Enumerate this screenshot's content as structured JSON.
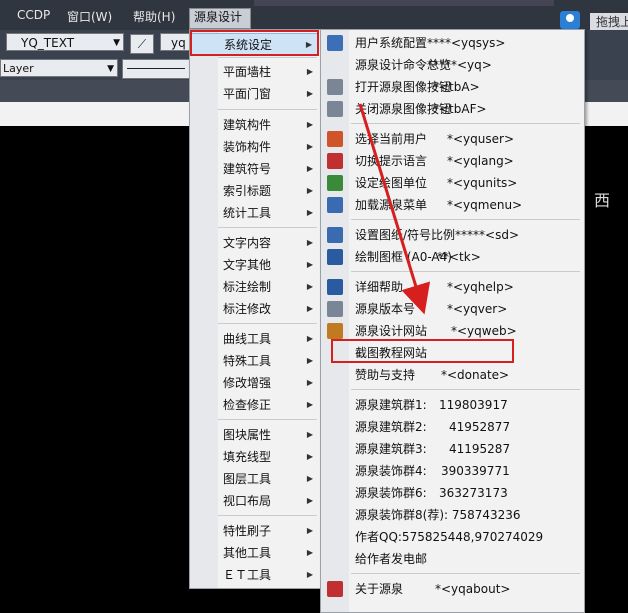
{
  "menubar": {
    "items": [
      "CCDP",
      "窗口(W)",
      "帮助(H)",
      "源泉设计"
    ],
    "drag_label": "拖拽上"
  },
  "toolbar": {
    "text_style": "YQ_TEXT",
    "style2": "yq",
    "layer": "Layer"
  },
  "viewcube_label": "西",
  "menu1": {
    "items": [
      {
        "label": "系统设定",
        "submenu": true
      },
      {
        "label": "平面墙柱",
        "submenu": true
      },
      {
        "label": "平面门窗",
        "submenu": true
      },
      {
        "label": "建筑构件",
        "submenu": true
      },
      {
        "label": "装饰构件",
        "submenu": true
      },
      {
        "label": "建筑符号",
        "submenu": true
      },
      {
        "label": "索引标题",
        "submenu": true
      },
      {
        "label": "统计工具",
        "submenu": true
      },
      {
        "label": "文字内容",
        "submenu": true
      },
      {
        "label": "文字其他",
        "submenu": true
      },
      {
        "label": "标注绘制",
        "submenu": true
      },
      {
        "label": "标注修改",
        "submenu": true
      },
      {
        "label": "曲线工具",
        "submenu": true
      },
      {
        "label": "特殊工具",
        "submenu": true
      },
      {
        "label": "修改增强",
        "submenu": true
      },
      {
        "label": "检查修正",
        "submenu": true
      },
      {
        "label": "图块属性",
        "submenu": true
      },
      {
        "label": "填充线型",
        "submenu": true
      },
      {
        "label": "图层工具",
        "submenu": true
      },
      {
        "label": "视口布局",
        "submenu": true
      },
      {
        "label": "特性刷子",
        "submenu": true
      },
      {
        "label": "其他工具",
        "submenu": true
      },
      {
        "label": "ＥＴ工具",
        "submenu": true
      }
    ]
  },
  "menu2": {
    "items": [
      {
        "label": "用户系统配置",
        "cmd": "****<yqsys>",
        "icon": "settings-icon",
        "color": "#3b6fb6"
      },
      {
        "label": "源泉设计命令总览",
        "cmd": "*****<yq>",
        "icon": "",
        "color": ""
      },
      {
        "label": "打开源泉图像按钮",
        "cmd": "*<tbA>",
        "icon": "toolbar-icon",
        "color": "#7a8696"
      },
      {
        "label": "关闭源泉图像按钮",
        "cmd": "*<tbAF>",
        "icon": "toolbar-off-icon",
        "color": "#7a8696"
      },
      {
        "label": "选择当前用户",
        "cmd": "*<yquser>",
        "icon": "user-icon",
        "color": "#d0542a"
      },
      {
        "label": "切换提示语言",
        "cmd": "*<yqlang>",
        "icon": "language-icon",
        "color": "#c03030"
      },
      {
        "label": "设定绘图单位",
        "cmd": "*<yqunits>",
        "icon": "units-icon",
        "color": "#3a8a3a"
      },
      {
        "label": "加载源泉菜单",
        "cmd": "*<yqmenu>",
        "icon": "menu-icon",
        "color": "#3a6ab0"
      },
      {
        "label": "设置图纸/符号比例*****<sd>",
        "cmd": "",
        "icon": "scale-icon",
        "color": "#3a6ab0"
      },
      {
        "label": "绘制图框 (A0-A4)",
        "cmd": "**<tk>",
        "icon": "frame-icon",
        "color": "#2a5aa0"
      },
      {
        "label": "详细帮助",
        "cmd": "*<yqhelp>",
        "icon": "help-icon",
        "color": "#2a5aa0"
      },
      {
        "label": "源泉版本号",
        "cmd": "*<yqver>",
        "icon": "version-icon",
        "color": "#7a8696"
      },
      {
        "label": "源泉设计网站",
        "cmd": "*<yqweb>",
        "icon": "home-icon",
        "color": "#c07a20"
      },
      {
        "label": "截图教程网站",
        "cmd": "",
        "icon": "",
        "color": ""
      },
      {
        "label": "赞助与支持",
        "cmd": "*<donate>",
        "icon": "",
        "color": ""
      },
      {
        "label": "源泉建筑群1:",
        "cmd": "119803917",
        "icon": "",
        "color": ""
      },
      {
        "label": "源泉建筑群2:",
        "cmd": "41952877",
        "icon": "",
        "color": ""
      },
      {
        "label": "源泉建筑群3:",
        "cmd": "41195287",
        "icon": "",
        "color": ""
      },
      {
        "label": "源泉装饰群4:",
        "cmd": "390339771",
        "icon": "",
        "color": ""
      },
      {
        "label": "源泉装饰群6:",
        "cmd": "363273173",
        "icon": "",
        "color": ""
      },
      {
        "label": "源泉装饰群8(荐): 758743236",
        "cmd": "",
        "icon": "",
        "color": ""
      },
      {
        "label": "作者QQ:575825448,970274029",
        "cmd": "",
        "icon": "",
        "color": ""
      },
      {
        "label": "给作者发电邮",
        "cmd": "",
        "icon": "",
        "color": ""
      },
      {
        "label": "关于源泉",
        "cmd": "*<yqabout>",
        "icon": "about-icon",
        "color": "#c03030"
      }
    ]
  }
}
